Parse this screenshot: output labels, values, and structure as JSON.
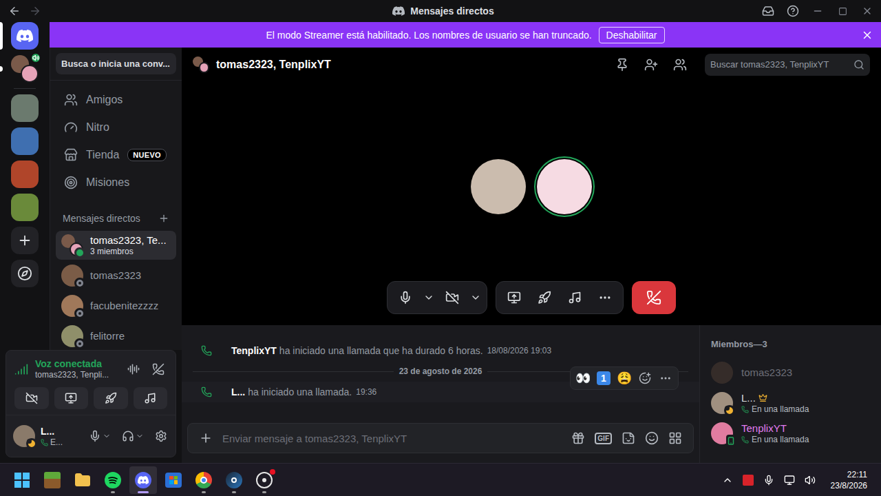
{
  "window": {
    "title": "Mensajes directos"
  },
  "banner": {
    "text": "El modo Streamer está habilitado. Los nombres de usuario se han truncado.",
    "button": "Deshabilitar"
  },
  "servers": [
    {
      "kind": "home",
      "selected": true,
      "unread": false,
      "in_voice": false
    },
    {
      "kind": "dm",
      "selected": false,
      "unread": true,
      "in_voice": true
    },
    {
      "kind": "server",
      "selected": false,
      "unread": false,
      "in_voice": false
    },
    {
      "kind": "server",
      "selected": false,
      "unread": false,
      "in_voice": false
    },
    {
      "kind": "server",
      "selected": false,
      "unread": false,
      "in_voice": false
    },
    {
      "kind": "server",
      "selected": false,
      "unread": false,
      "in_voice": false
    },
    {
      "kind": "add",
      "selected": false,
      "unread": false,
      "in_voice": false
    },
    {
      "kind": "discover",
      "selected": false,
      "unread": false,
      "in_voice": false
    }
  ],
  "sidebar": {
    "search": "Busca o inicia una conv...",
    "nav": [
      {
        "label": "Amigos",
        "selected": false,
        "badge": ""
      },
      {
        "label": "Nitro",
        "selected": false,
        "badge": ""
      },
      {
        "label": "Tienda",
        "selected": false,
        "badge": "NUEVO"
      },
      {
        "label": "Misiones",
        "selected": false,
        "badge": ""
      }
    ],
    "dm_header": "Mensajes directos",
    "dms": [
      {
        "name": "tomas2323, Te...",
        "subtitle": "3 miembros",
        "kind": "group",
        "status": "online",
        "selected": true
      },
      {
        "name": "tomas2323",
        "subtitle": "",
        "kind": "user",
        "status": "offline",
        "selected": false
      },
      {
        "name": "facubenitezzzz",
        "subtitle": "",
        "kind": "user",
        "status": "offline",
        "selected": false
      },
      {
        "name": "felitorre",
        "subtitle": "",
        "kind": "user",
        "status": "offline",
        "selected": false
      }
    ]
  },
  "voice": {
    "title": "Voz conectada",
    "channel": "tomas2323, Tenpli..."
  },
  "user": {
    "name": "L...",
    "status_text": "E...",
    "status": "idle",
    "muted": false,
    "deafened": false
  },
  "chat": {
    "title": "tomas2323, TenplixYT",
    "search_placeholder": "Buscar tomas2323, TenplixYT",
    "input_placeholder": "Enviar mensaje a tomas2323, TenplixYT",
    "gif": "GIF"
  },
  "call": {
    "camera_off": true,
    "muted": false,
    "participants": [
      {
        "speaking": false
      },
      {
        "speaking": true
      }
    ]
  },
  "messages": [
    {
      "kind": "call",
      "author": "TenplixYT",
      "text": "ha iniciado una llamada que ha durado 6 horas.",
      "time": "18/08/2026 19:03",
      "hovered": false
    },
    {
      "kind": "divider",
      "author": "",
      "text": "23 de agosto de 2026",
      "time": "",
      "hovered": false
    },
    {
      "kind": "call",
      "author": "L...",
      "text": "ha iniciado una llamada.",
      "time": "19:36",
      "hovered": true
    }
  ],
  "message_actions": [
    {
      "kind": "emoji",
      "text": "👀"
    },
    {
      "kind": "keycap",
      "text": "1"
    },
    {
      "kind": "emoji",
      "text": "😩"
    }
  ],
  "members": {
    "title": "Miembros—3",
    "list": [
      {
        "name": "tomas2323",
        "status": "offline",
        "owner": false,
        "activity": "",
        "color": "#6d6f78"
      },
      {
        "name": "L...",
        "status": "idle",
        "owner": true,
        "activity": "En una llamada",
        "color": "#dbdee1"
      },
      {
        "name": "TenplixYT",
        "status": "mobile",
        "owner": false,
        "activity": "En una llamada",
        "color": "#e07cf0"
      }
    ]
  },
  "taskbar": {
    "apps": [
      {
        "kind": "start",
        "running": false,
        "selected": false,
        "badge": false
      },
      {
        "kind": "minecraft",
        "running": false,
        "selected": false,
        "badge": false
      },
      {
        "kind": "explorer",
        "running": false,
        "selected": false,
        "badge": false
      },
      {
        "kind": "spotify",
        "running": true,
        "selected": false,
        "badge": false
      },
      {
        "kind": "discord",
        "running": true,
        "selected": true,
        "badge": false
      },
      {
        "kind": "store",
        "running": false,
        "selected": false,
        "badge": false
      },
      {
        "kind": "chrome",
        "running": true,
        "selected": false,
        "badge": false
      },
      {
        "kind": "steam",
        "running": true,
        "selected": false,
        "badge": false
      },
      {
        "kind": "other",
        "running": true,
        "selected": false,
        "badge": true
      }
    ],
    "clock": {
      "time": "22:11",
      "date": "23/8/2026"
    }
  }
}
